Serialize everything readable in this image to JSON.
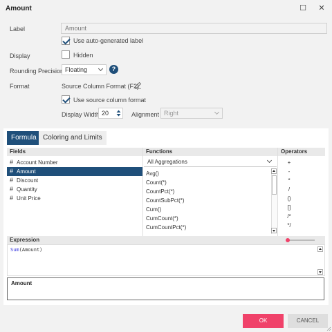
{
  "window": {
    "title": "Amount",
    "maximize_glyph": "☐",
    "close_glyph": "✕"
  },
  "label_row": {
    "label": "Label",
    "placeholder": "Amount"
  },
  "auto_label": {
    "text": "Use auto-generated label",
    "checked": true
  },
  "display_row": {
    "label": "Display",
    "hidden_text": "Hidden",
    "checked": false
  },
  "rounding": {
    "label": "Rounding Precision",
    "value": "Floating",
    "help": "?"
  },
  "format": {
    "label": "Format",
    "value": "Source Column Format (F2)",
    "edit_icon": "pencil-icon"
  },
  "source_format": {
    "text": "Use source column format",
    "checked": true
  },
  "display_width": {
    "label": "Display Width",
    "value": "20"
  },
  "alignment": {
    "label": "Alignment",
    "value": "Right"
  },
  "tabs": [
    {
      "label": "Formula",
      "active": true
    },
    {
      "label": "Coloring and Limits",
      "active": false
    }
  ],
  "fields": {
    "header": "Fields",
    "items": [
      "Account Number",
      "Amount",
      "Discount",
      "Quantity",
      "Unit Price"
    ],
    "selected": "Amount"
  },
  "functions": {
    "header": "Functions",
    "filter": "All Aggregations",
    "items": [
      "Avg()",
      "Count(*)",
      "CountPct(*)",
      "CountSubPct(*)",
      "Cum()",
      "CumCount(*)",
      "CumCountPct(*)"
    ]
  },
  "operators": {
    "header": "Operators",
    "items": [
      "+",
      "-",
      "*",
      "/",
      "()",
      "[]",
      "/* */"
    ]
  },
  "expression": {
    "header": "Expression",
    "func": "Sum",
    "rest": "(Amount)"
  },
  "preview": {
    "title": "Amount"
  },
  "buttons": {
    "ok": "OK",
    "cancel": "CANCEL"
  },
  "colors": {
    "accent": "#1f4f7a",
    "ok": "#f0426a"
  }
}
